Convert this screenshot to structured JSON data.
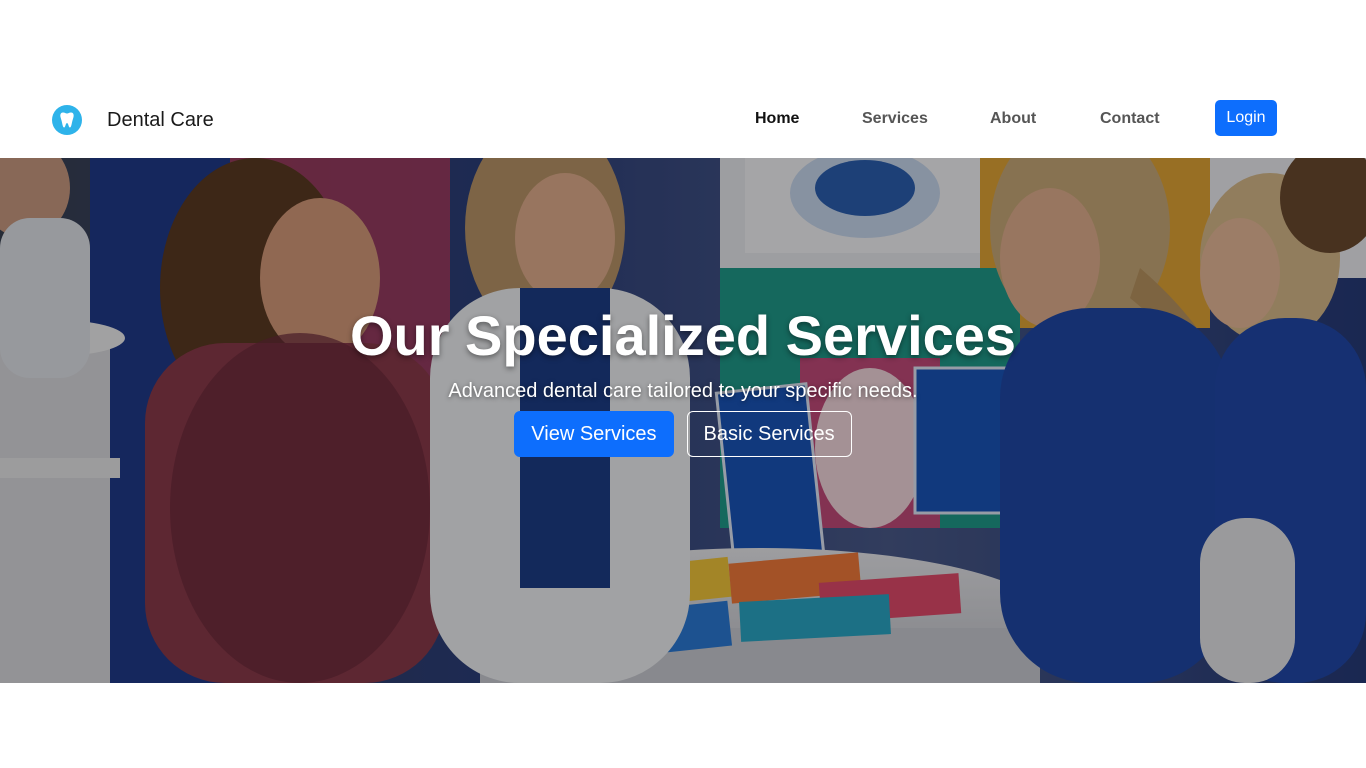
{
  "brand": {
    "name": "Dental Care",
    "logo_icon": "tooth-icon",
    "logo_color": "#2eb3ea"
  },
  "nav": {
    "items": [
      {
        "label": "Home",
        "active": true
      },
      {
        "label": "Services",
        "active": false
      },
      {
        "label": "About",
        "active": false
      },
      {
        "label": "Contact",
        "active": false
      }
    ],
    "login_label": "Login"
  },
  "hero": {
    "title": "Our Specialized Services",
    "subtitle": "Advanced dental care tailored to your specific needs.",
    "primary_button": "View Services",
    "secondary_button": "Basic Services"
  },
  "colors": {
    "accent": "#0d6efd",
    "text_dark": "#111111",
    "nav_text": "#555555"
  }
}
